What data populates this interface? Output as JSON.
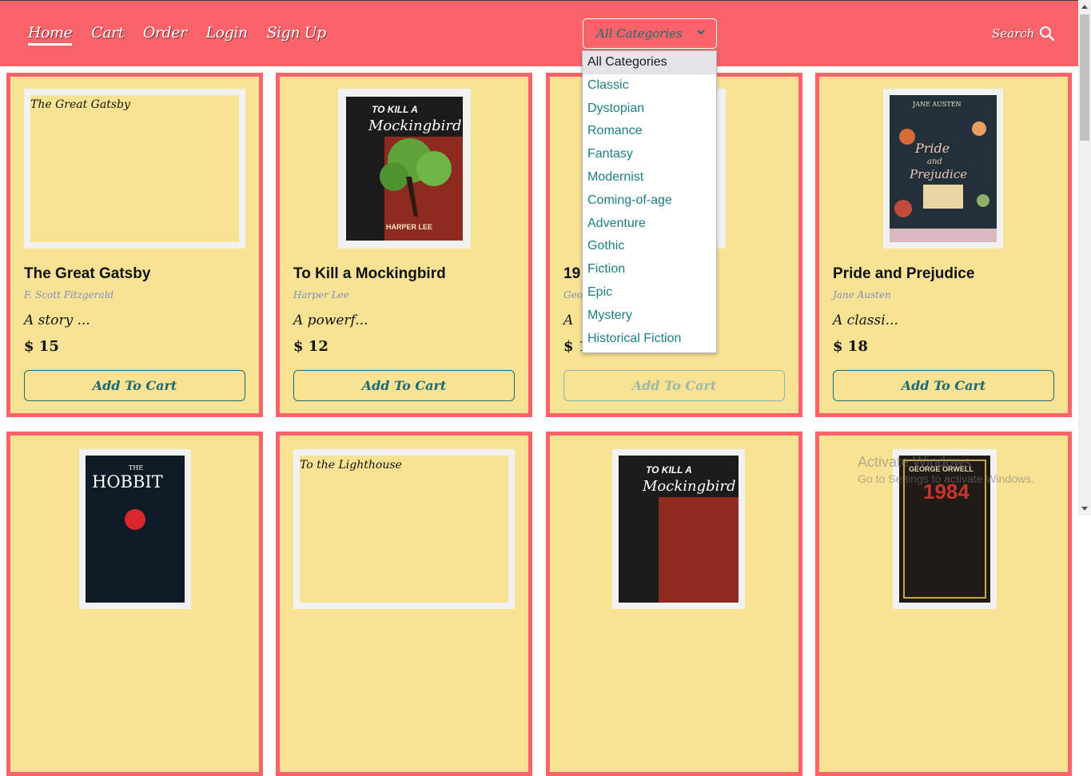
{
  "nav": {
    "links": [
      "Home",
      "Cart",
      "Order",
      "Login",
      "Sign Up"
    ],
    "active": "Home"
  },
  "category_select": {
    "value": "All Categories",
    "options": [
      "All Categories",
      "Classic",
      "Dystopian",
      "Romance",
      "Fantasy",
      "Modernist",
      "Coming-of-age",
      "Adventure",
      "Gothic",
      "Fiction",
      "Epic",
      "Mystery",
      "Historical Fiction"
    ]
  },
  "search": {
    "label": "Search",
    "icon": "search-icon"
  },
  "add_label": "Add To Cart",
  "books": [
    {
      "title": "The Great Gatsby",
      "author": "F. Scott Fitzgerald",
      "desc": "A story ...",
      "price": "$ 15",
      "cover_text": "The Great Gatsby"
    },
    {
      "title": "To Kill a Mockingbird",
      "author": "Harper Lee",
      "desc": "A powerf...",
      "price": "$ 12",
      "cover_text": ""
    },
    {
      "title": "19",
      "author": "Geor",
      "desc": "A",
      "price": "$ 1",
      "cover_text": ""
    },
    {
      "title": "Pride and Prejudice",
      "author": "Jane Austen",
      "desc": "A classi...",
      "price": "$ 18",
      "cover_text": ""
    }
  ],
  "row2_covers": [
    {
      "cover_text": ""
    },
    {
      "cover_text": "To the Lighthouse"
    },
    {
      "cover_text": ""
    },
    {
      "cover_text": ""
    }
  ],
  "cover_art": {
    "mockingbird_top": "TO KILL A",
    "mockingbird_title": "Mockingbird",
    "mockingbird_author": "HARPER LEE",
    "austen_author": "JANE AUSTEN",
    "austen_title": "Pride and Prejudice",
    "hobbit_the": "THE",
    "hobbit_title": "HOBBIT",
    "orwell_author": "GEORGE ORWELL",
    "orwell_title": "1984"
  },
  "watermark": {
    "line1": "Activate Windows",
    "line2": "Go to Settings to activate Windows."
  },
  "colors": {
    "header": "#fb636b",
    "card": "#f8e394",
    "accent": "#1d6a72"
  }
}
